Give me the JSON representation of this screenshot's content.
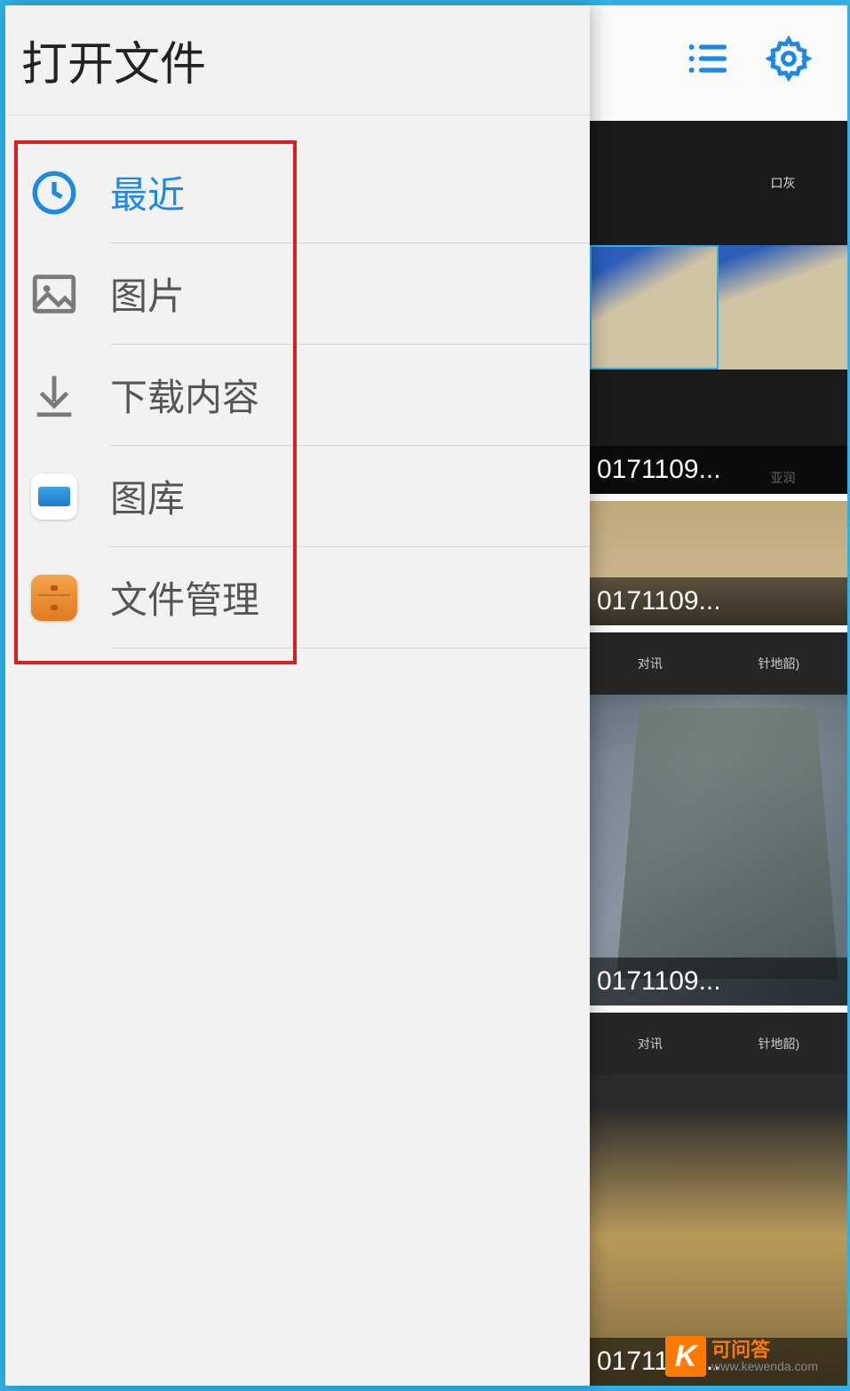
{
  "header": {
    "title": "打开文件"
  },
  "drawer": {
    "items": [
      {
        "label": "最近",
        "icon": "clock-icon",
        "active": true
      },
      {
        "label": "图片",
        "icon": "image-icon",
        "active": false
      },
      {
        "label": "下载内容",
        "icon": "download-icon",
        "active": false
      },
      {
        "label": "图库",
        "icon": "gallery-app-icon",
        "active": false
      },
      {
        "label": "文件管理",
        "icon": "files-app-icon",
        "active": false
      }
    ]
  },
  "toolbar": {
    "list_view": "list-view-icon",
    "settings": "settings-icon"
  },
  "thumbnails": [
    {
      "caption": "0171109...",
      "sublabels": [
        "口灰",
        "亚润"
      ]
    },
    {
      "caption": "0171109..."
    },
    {
      "caption": "0171109...",
      "topbar": [
        "对讯",
        "针地韶)"
      ]
    },
    {
      "caption": "0171109...",
      "topbar": [
        "对讯",
        "针地韶)"
      ]
    }
  ],
  "watermark": {
    "logo": "K",
    "title": "可问答",
    "url": "www.kewenda.com"
  },
  "colors": {
    "accent": "#1e88e5",
    "frame": "#2fb0e6",
    "highlight": "#d62020",
    "brand": "#ff7a00"
  }
}
